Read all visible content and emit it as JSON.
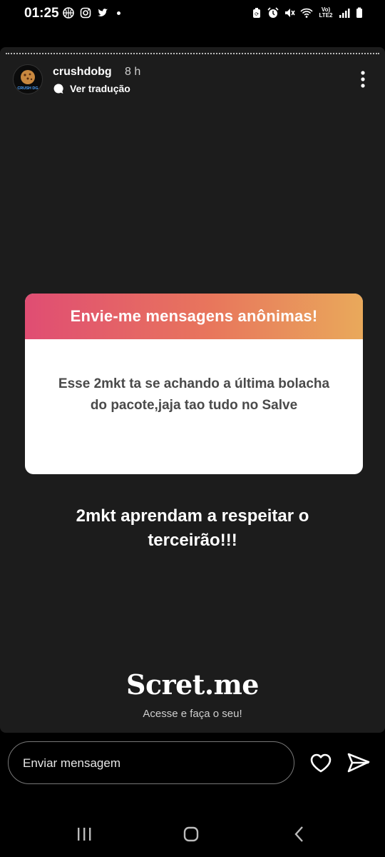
{
  "status_bar": {
    "time": "01:25",
    "left_icons": [
      "basketball-icon",
      "instagram-icon",
      "twitter-icon",
      "notification-dot"
    ],
    "right_icons": [
      "battery-saver-icon",
      "alarm-icon",
      "mute-icon",
      "wifi-icon",
      "volte-icon",
      "signal-icon",
      "battery-icon"
    ],
    "network_label": "Vo) LTE2"
  },
  "story": {
    "username": "crushdobg",
    "time_ago": "8 h",
    "translate_label": "Ver tradução",
    "avatar_text": "CRUSH DG",
    "question_card": {
      "title": "Envie-me mensagens anônimas!",
      "message": "Esse 2mkt ta se achando a última bolacha do pacote,jaja tao tudo no Salve"
    },
    "caption": "2mkt aprendam a respeitar o terceirão!!!",
    "brand": "Scret.me",
    "brand_subtitle": "Acesse e faça o seu!"
  },
  "reply_bar": {
    "placeholder": "Enviar mensagem"
  },
  "colors": {
    "gradient_start": "#e04d73",
    "gradient_end": "#e9a95b",
    "story_bg": "#1c1c1c"
  }
}
